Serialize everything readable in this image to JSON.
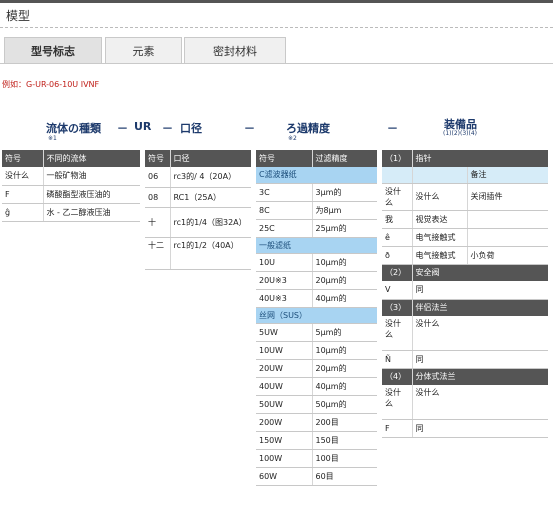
{
  "page": {
    "title": "模型"
  },
  "tabs": [
    {
      "label": "型号标志"
    },
    {
      "label": "元素"
    },
    {
      "label": "密封材料"
    }
  ],
  "example": "例如：G-UR-06-10U IVNF",
  "code_line": {
    "fluid": "流体の種類",
    "fluid_note": "※1",
    "dash1": "－",
    "ur": "UR",
    "dash2": "－",
    "port": "口径",
    "dash3": "－",
    "precision": "ろ過精度",
    "precision_note": "※2",
    "dash4": "－",
    "accessories": "装備品",
    "accessories_note": "(1)(2)(3)(4)"
  },
  "fluid_table": {
    "headers": [
      "符号",
      "不同的流体"
    ],
    "rows": [
      [
        "没什么",
        "一般矿物油"
      ],
      [
        "F",
        "磷酸酯型液压油的"
      ],
      [
        "ĝ",
        "水 - 乙二醇液压油"
      ]
    ]
  },
  "port_table": {
    "headers": [
      "符号",
      "口径"
    ],
    "rows": [
      [
        "06",
        "rc3的/ 4（20A）"
      ],
      [
        "08",
        "RC1（25A）"
      ],
      [
        "十",
        "rc1的1/4（图32A）"
      ],
      [
        "十二",
        "rc1的1/2（40A）"
      ]
    ]
  },
  "precision_table": {
    "headers": [
      "符号",
      "过滤精度"
    ],
    "groups": [
      {
        "name": "C滤波器纸",
        "rows": [
          [
            "3C",
            "3μm的"
          ],
          [
            "8C",
            "为8μm"
          ],
          [
            "25C",
            "25μm的"
          ]
        ]
      },
      {
        "name": "一般滤纸",
        "rows": [
          [
            "10U",
            "10μm的"
          ],
          [
            "20U※3",
            "20μm的"
          ],
          [
            "40U※3",
            "40μm的"
          ]
        ]
      },
      {
        "name": "丝网（SUS）",
        "rows": [
          [
            "5UW",
            "5μm的"
          ],
          [
            "10UW",
            "10μm的"
          ],
          [
            "20UW",
            "20μm的"
          ],
          [
            "40UW",
            "40μm的"
          ],
          [
            "50UW",
            "50μm的"
          ],
          [
            "200W",
            "200目"
          ],
          [
            "150W",
            "150目"
          ],
          [
            "100W",
            "100目"
          ],
          [
            "60W",
            "60目"
          ]
        ]
      }
    ]
  },
  "accessories_table": {
    "indicator": {
      "num": "（1）",
      "title": "指针",
      "remark": "备注",
      "rows": [
        [
          "没什么",
          "没什么",
          "关闭插件"
        ],
        [
          "我",
          "视觉表达",
          ""
        ],
        [
          "ê",
          "电气接触式",
          ""
        ],
        [
          "ð",
          "电气接触式",
          "小负荷"
        ]
      ]
    },
    "safety_valve": {
      "num": "（2）",
      "title": "安全阀",
      "rows": [
        [
          "V",
          "同"
        ]
      ]
    },
    "companion_flange": {
      "num": "（3）",
      "title": "伴侣法兰",
      "rows": [
        [
          "没什么",
          "没什么"
        ],
        [
          "Ñ",
          "同"
        ]
      ]
    },
    "split_flange": {
      "num": "（4）",
      "title": "分体式法兰",
      "rows": [
        [
          "没什么",
          "没什么"
        ],
        [
          "F",
          "同"
        ]
      ]
    }
  }
}
